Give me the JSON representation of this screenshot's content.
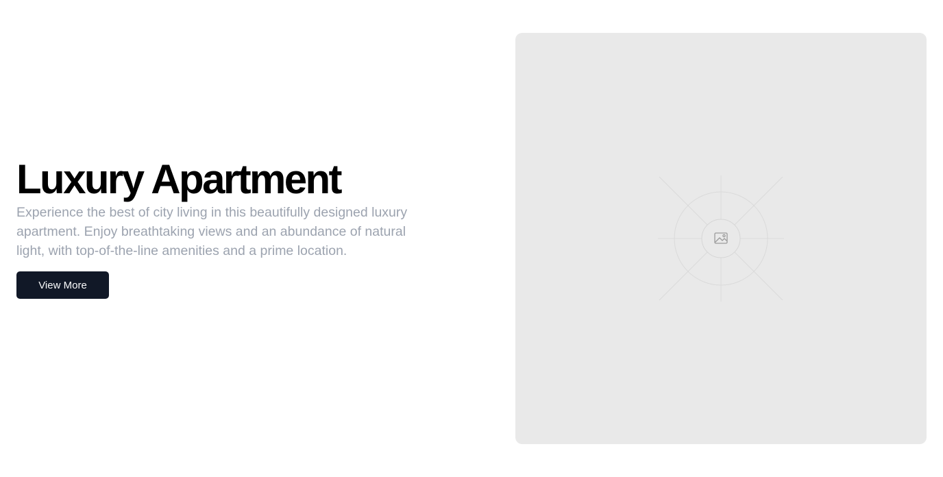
{
  "hero": {
    "title": "Luxury Apartment",
    "description": "Experience the best of city living in this beautifully designed luxury apartment. Enjoy breathtaking views and an abundance of natural light, with top-of-the-line amenities and a prime location.",
    "button_label": "View More"
  },
  "media": {
    "icon": "image-icon",
    "background_color": "#e9e9e9"
  },
  "colors": {
    "title": "#000000",
    "description": "#9ca3af",
    "button_bg": "#111827",
    "button_text": "#f9fafb"
  }
}
